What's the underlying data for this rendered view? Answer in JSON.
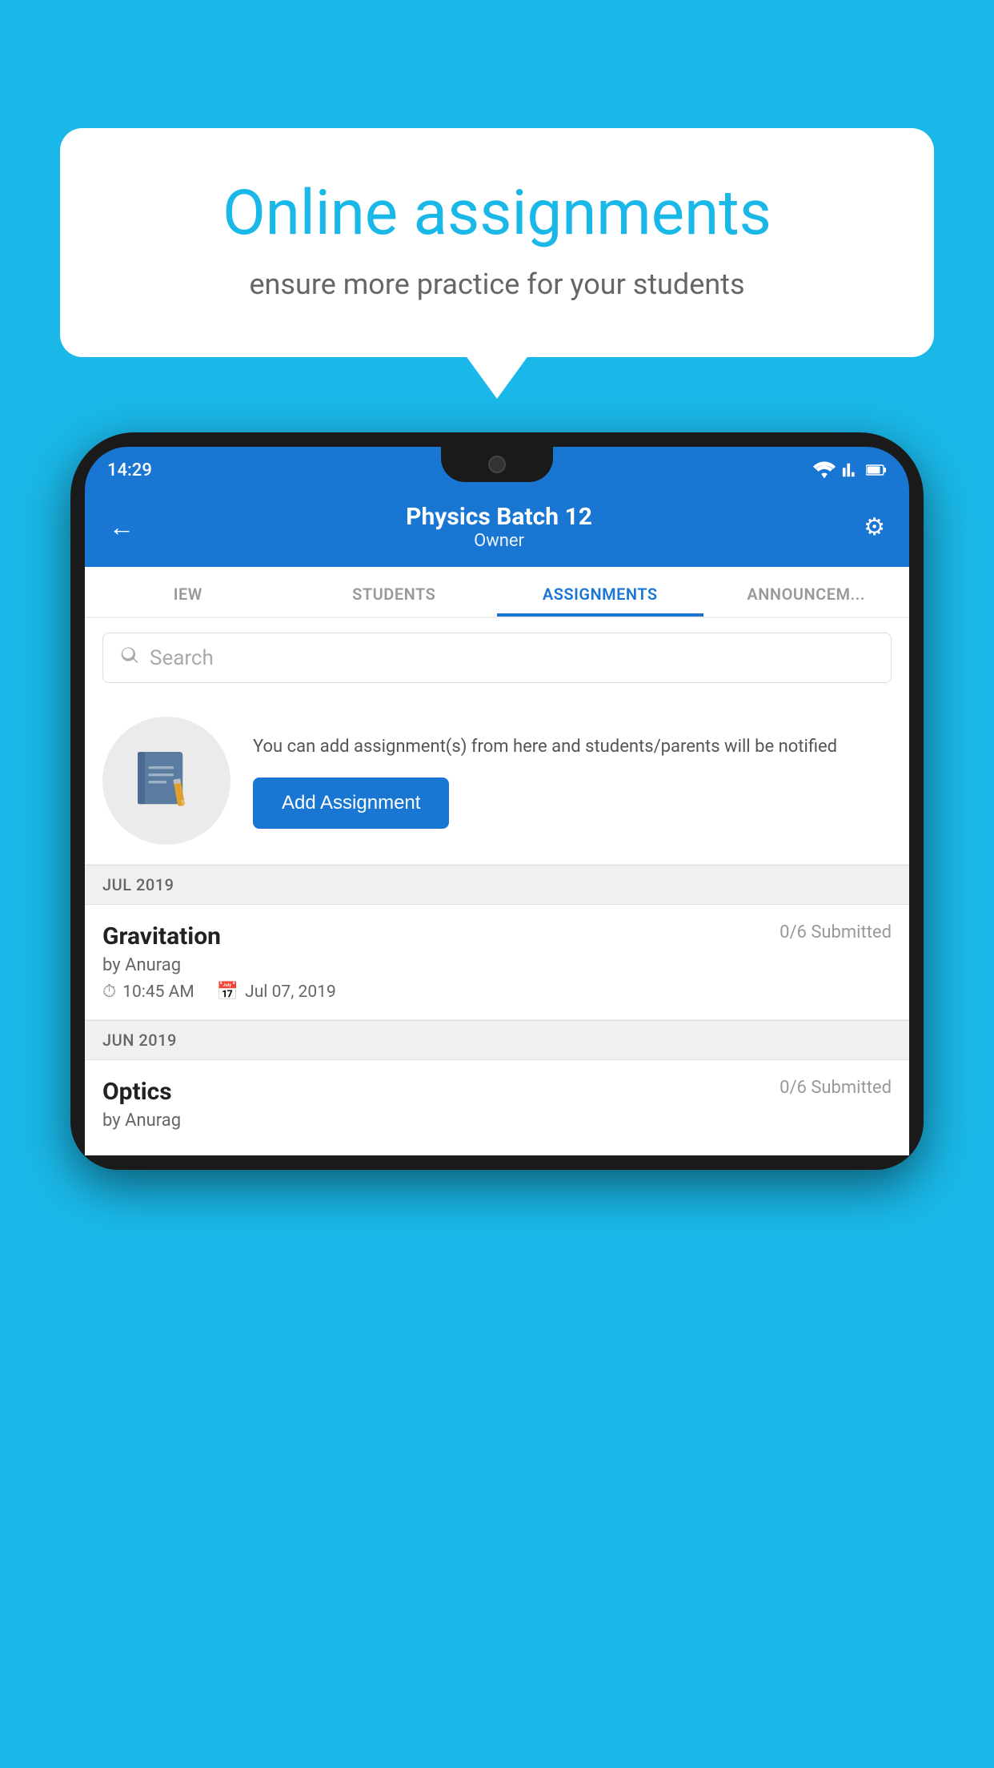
{
  "background_color": "#1ab8e8",
  "speech_bubble": {
    "title": "Online assignments",
    "subtitle": "ensure more practice for your students"
  },
  "phone": {
    "status_bar": {
      "time": "14:29",
      "icons": [
        "wifi",
        "signal",
        "battery"
      ]
    },
    "header": {
      "title": "Physics Batch 12",
      "subtitle": "Owner",
      "back_label": "←",
      "settings_label": "⚙"
    },
    "tabs": [
      {
        "label": "IEW",
        "active": false
      },
      {
        "label": "STUDENTS",
        "active": false
      },
      {
        "label": "ASSIGNMENTS",
        "active": true
      },
      {
        "label": "ANNOUNCEM...",
        "active": false
      }
    ],
    "search": {
      "placeholder": "Search"
    },
    "add_assignment": {
      "description": "You can add assignment(s) from here and students/parents will be notified",
      "button_label": "Add Assignment"
    },
    "month_sections": [
      {
        "month_label": "JUL 2019",
        "assignments": [
          {
            "name": "Gravitation",
            "submitted": "0/6 Submitted",
            "by": "by Anurag",
            "time": "10:45 AM",
            "date": "Jul 07, 2019"
          }
        ]
      },
      {
        "month_label": "JUN 2019",
        "assignments": [
          {
            "name": "Optics",
            "submitted": "0/6 Submitted",
            "by": "by Anurag",
            "time": "",
            "date": ""
          }
        ]
      }
    ]
  }
}
